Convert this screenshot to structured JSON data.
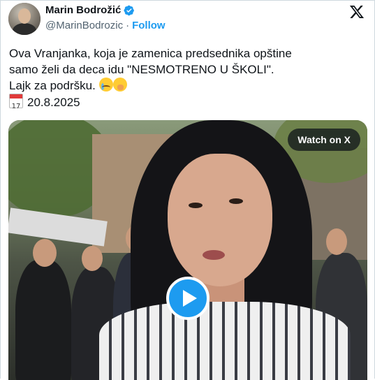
{
  "author": {
    "name": "Marin Bodrožić",
    "handle": "@MarinBodrozic",
    "separator": "·",
    "follow_label": "Follow",
    "verified_color": "#1d9bf0"
  },
  "icons": {
    "logo": "x-logo-icon",
    "verified": "verified-badge-icon",
    "play": "play-icon",
    "calendar": "calendar-icon"
  },
  "tweet": {
    "line1": "Ova Vranjanka, koja je zamenica predsednika opštine",
    "line2": "samo želi da deca idu \"NESMOTRENO U ŠKOLI\".",
    "line3": "Lajk za podršku.",
    "calendar_day": "17",
    "date": "20.8.2025"
  },
  "media": {
    "watch_label": "Watch on X",
    "play_color": "#1d9bf0"
  }
}
